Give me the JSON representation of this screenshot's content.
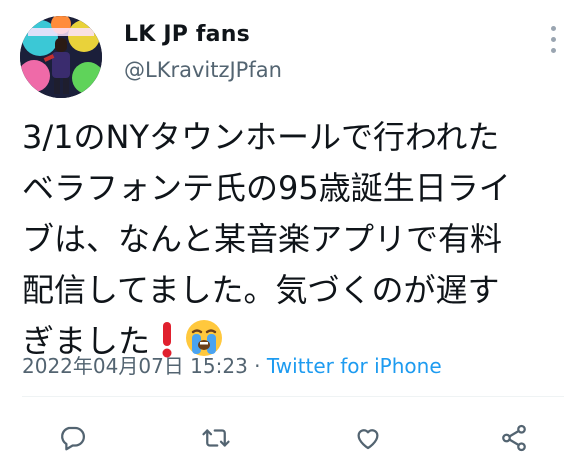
{
  "user": {
    "display_name": "LK JP fans",
    "handle": "@LKravitzJPfan"
  },
  "tweet": {
    "lines": [
      "3/1のNYタウンホールで行われた",
      "ベラフォンテ氏の95歳誕生日ライ",
      "ブは、なんと某音楽アプリで有料",
      "配信してました。気づくのが遅す",
      "ぎました"
    ]
  },
  "meta": {
    "timestamp": "2022年04月07日 15:23",
    "separator": " · ",
    "source": "Twitter for iPhone"
  },
  "icons": {
    "reply": "reply-icon",
    "retweet": "retweet-icon",
    "like": "like-icon",
    "share": "share-icon"
  },
  "colors": {
    "accent": "#1d9bf0",
    "secondary_text": "#536471",
    "icon": "#536471"
  }
}
